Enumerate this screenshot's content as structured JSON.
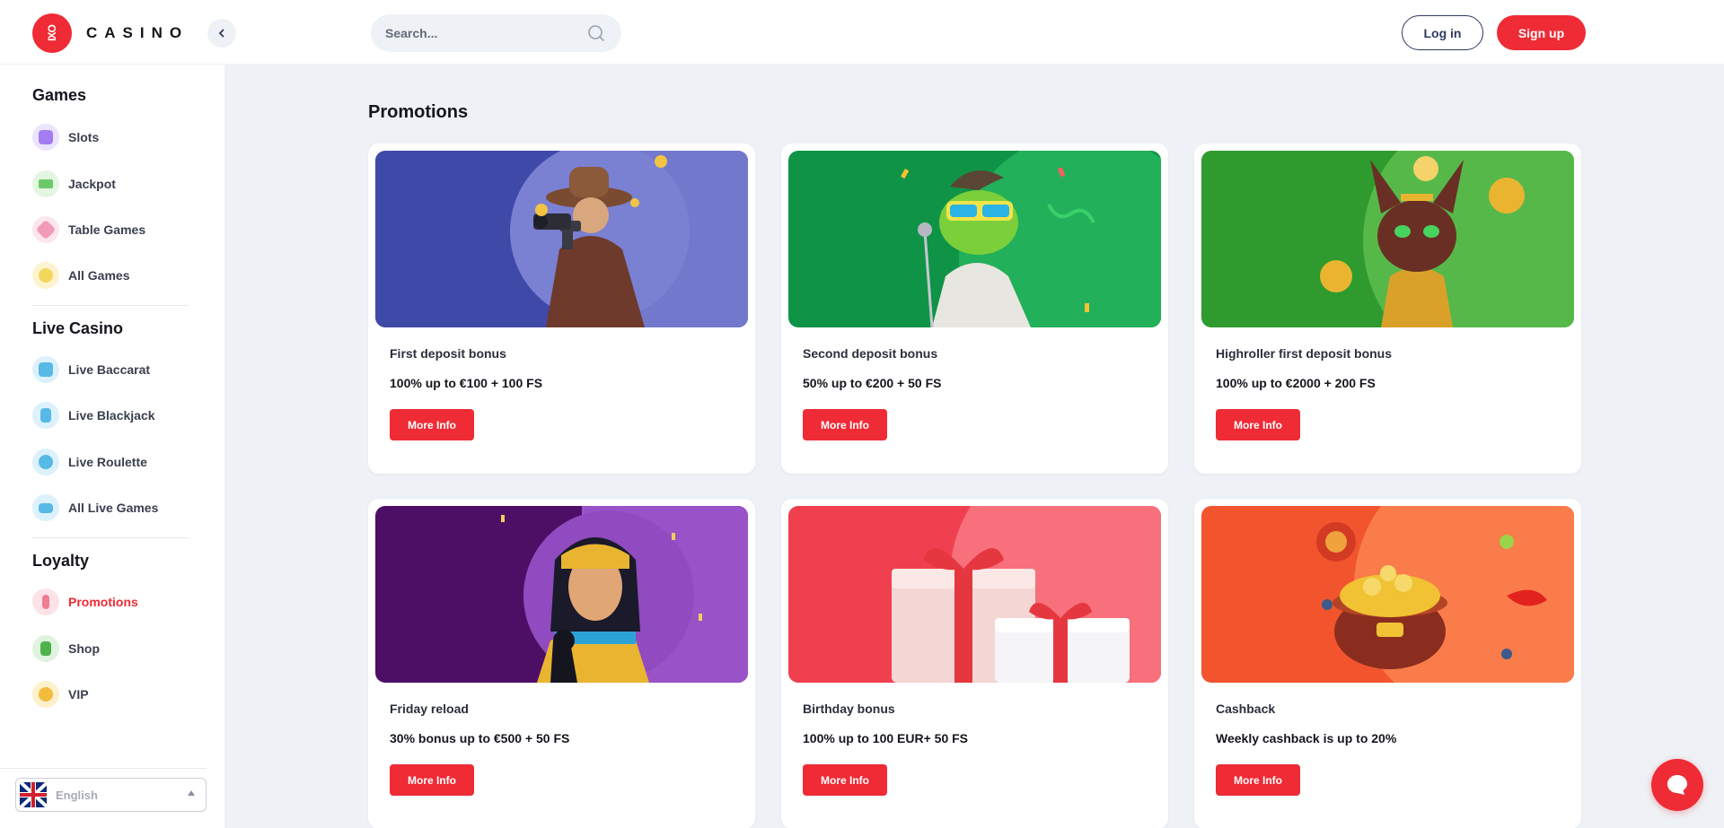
{
  "brand": {
    "mark": "IXO",
    "name": "CASINO",
    "accent": "#ef2b36"
  },
  "header": {
    "collapse_icon": "chevron-left-icon",
    "search": {
      "placeholder": "Search...",
      "icon": "search-icon"
    },
    "login_label": "Log in",
    "signup_label": "Sign up"
  },
  "sidebar": {
    "sections": [
      {
        "title": "Games",
        "items": [
          {
            "label": "Slots",
            "icon": "slots-icon",
            "color": "#b59cf7"
          },
          {
            "label": "Jackpot",
            "icon": "jackpot-icon",
            "color": "#7fd67a"
          },
          {
            "label": "Table Games",
            "icon": "table-games-icon",
            "color": "#f4a6c1"
          },
          {
            "label": "All Games",
            "icon": "all-games-icon",
            "color": "#f7df73"
          }
        ]
      },
      {
        "title": "Live Casino",
        "items": [
          {
            "label": "Live Baccarat",
            "icon": "live-baccarat-icon",
            "color": "#6cc7ee"
          },
          {
            "label": "Live Blackjack",
            "icon": "live-blackjack-icon",
            "color": "#6cc7ee"
          },
          {
            "label": "Live Roulette",
            "icon": "live-roulette-icon",
            "color": "#6cc7ee"
          },
          {
            "label": "All Live Games",
            "icon": "all-live-games-icon",
            "color": "#6cc7ee"
          }
        ]
      },
      {
        "title": "Loyalty",
        "items": [
          {
            "label": "Promotions",
            "icon": "promotions-icon",
            "color": "#f48a9c",
            "active": true
          },
          {
            "label": "Shop",
            "icon": "shop-icon",
            "color": "#5fc45a"
          },
          {
            "label": "VIP",
            "icon": "vip-icon",
            "color": "#f6c64c"
          }
        ]
      }
    ],
    "language": {
      "label": "English",
      "flag": "uk-flag-icon"
    }
  },
  "main": {
    "title": "Promotions",
    "cards": [
      {
        "title": "First deposit bonus",
        "offer": "100% up to €100 + 100 FS",
        "button": "More Info",
        "bg": "#3f49a8",
        "bg2": "#7278cc",
        "art": "cowboy-gunslinger-illustration"
      },
      {
        "title": "Second deposit bonus",
        "offer": "50% up to €200 + 50 FS",
        "button": "More Info",
        "bg": "#0f9447",
        "bg2": "#22b05a",
        "art": "frog-singer-illustration"
      },
      {
        "title": "Highroller first deposit bonus",
        "offer": "100% up to €2000 + 200 FS",
        "button": "More Info",
        "bg": "#2f9a2e",
        "bg2": "#57b84a",
        "art": "egyptian-cat-illustration"
      },
      {
        "title": "Friday reload",
        "offer": "30% bonus up to €500 + 50 FS",
        "button": "More Info",
        "bg": "#4d0f66",
        "bg2": "#9a52c9",
        "art": "cleopatra-illustration"
      },
      {
        "title": "Birthday bonus",
        "offer": "100% up to 100 EUR+ 50 FS",
        "button": "More Info",
        "bg": "#f04050",
        "bg2": "#f7707b",
        "art": "gift-boxes-illustration"
      },
      {
        "title": "Cashback",
        "offer": "Weekly cashback is up to 20%",
        "button": "More Info",
        "bg": "#f2552d",
        "bg2": "#f97c4a",
        "art": "gold-pot-illustration"
      }
    ]
  },
  "chat": {
    "icon": "chat-bubble-icon"
  }
}
